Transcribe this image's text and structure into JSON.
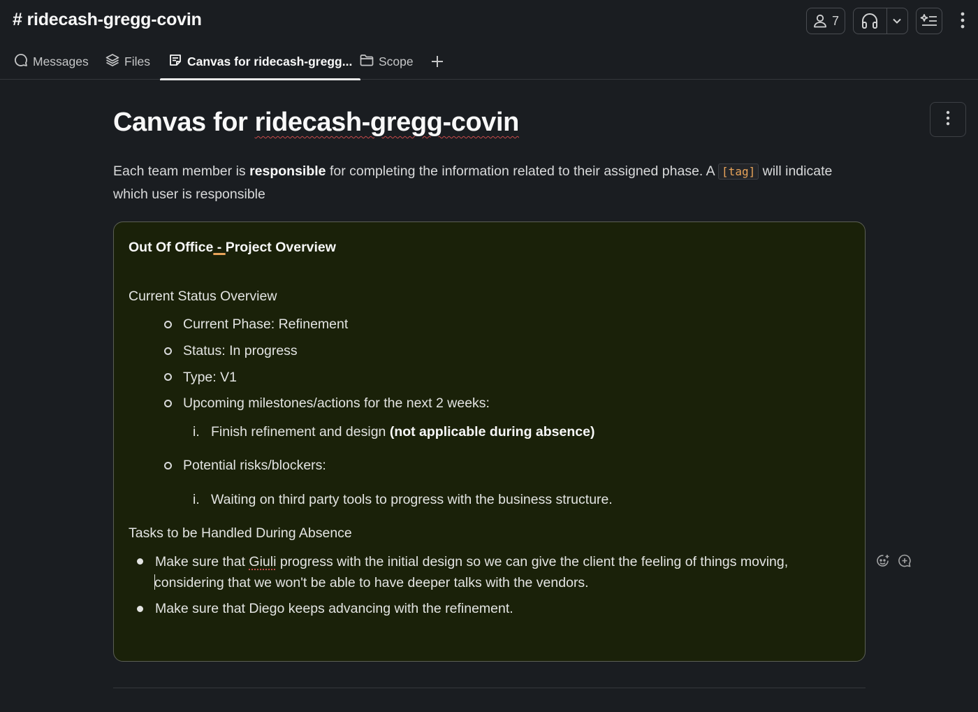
{
  "header": {
    "channel_title": "# ridecash-gregg-covin",
    "member_count": "7"
  },
  "tabs": [
    {
      "label": "Messages",
      "icon": "chat-bubble-icon"
    },
    {
      "label": "Files",
      "icon": "layers-icon"
    },
    {
      "label": "Canvas for ridecash-gregg...",
      "icon": "canvas-icon",
      "active": true
    },
    {
      "label": "Scope",
      "icon": "folder-icon"
    }
  ],
  "canvas": {
    "title_prefix": "Canvas for ",
    "title_name": "ridecash-gregg-covin",
    "intro": {
      "part1": "Each team member is ",
      "bold": "responsible",
      "part2": " for completing the information related to their assigned phase. A ",
      "tag": "[tag]",
      "part3": " will indicate",
      "line2": "which user is responsible"
    },
    "callout": {
      "heading_a": "Out Of Office",
      "heading_dash": " - ",
      "heading_b": "Project Overview",
      "section1": "Current Status Overview",
      "status_items": [
        "Current Phase: Refinement",
        "Status: In progress",
        "Type: V1",
        "Upcoming milestones/actions for the next 2 weeks:"
      ],
      "milestone_num": "i.",
      "milestone_text": "Finish refinement and design ",
      "milestone_bold": "(not applicable during absence)",
      "risks_label": "Potential risks/blockers:",
      "risk_num": "i.",
      "risk_text": "Waiting on third party tools to progress with the business structure.",
      "section2": "Tasks to be Handled During Absence",
      "task1_a": "Make sure that ",
      "task1_name": "Giuli",
      "task1_b": " progress with the initial design so we can give the client the feeling of things moving,",
      "task1_line2": "considering that we won't be able to have deeper talks with the vendors.",
      "task2": "Make sure that Diego keeps advancing with the refinement."
    }
  }
}
